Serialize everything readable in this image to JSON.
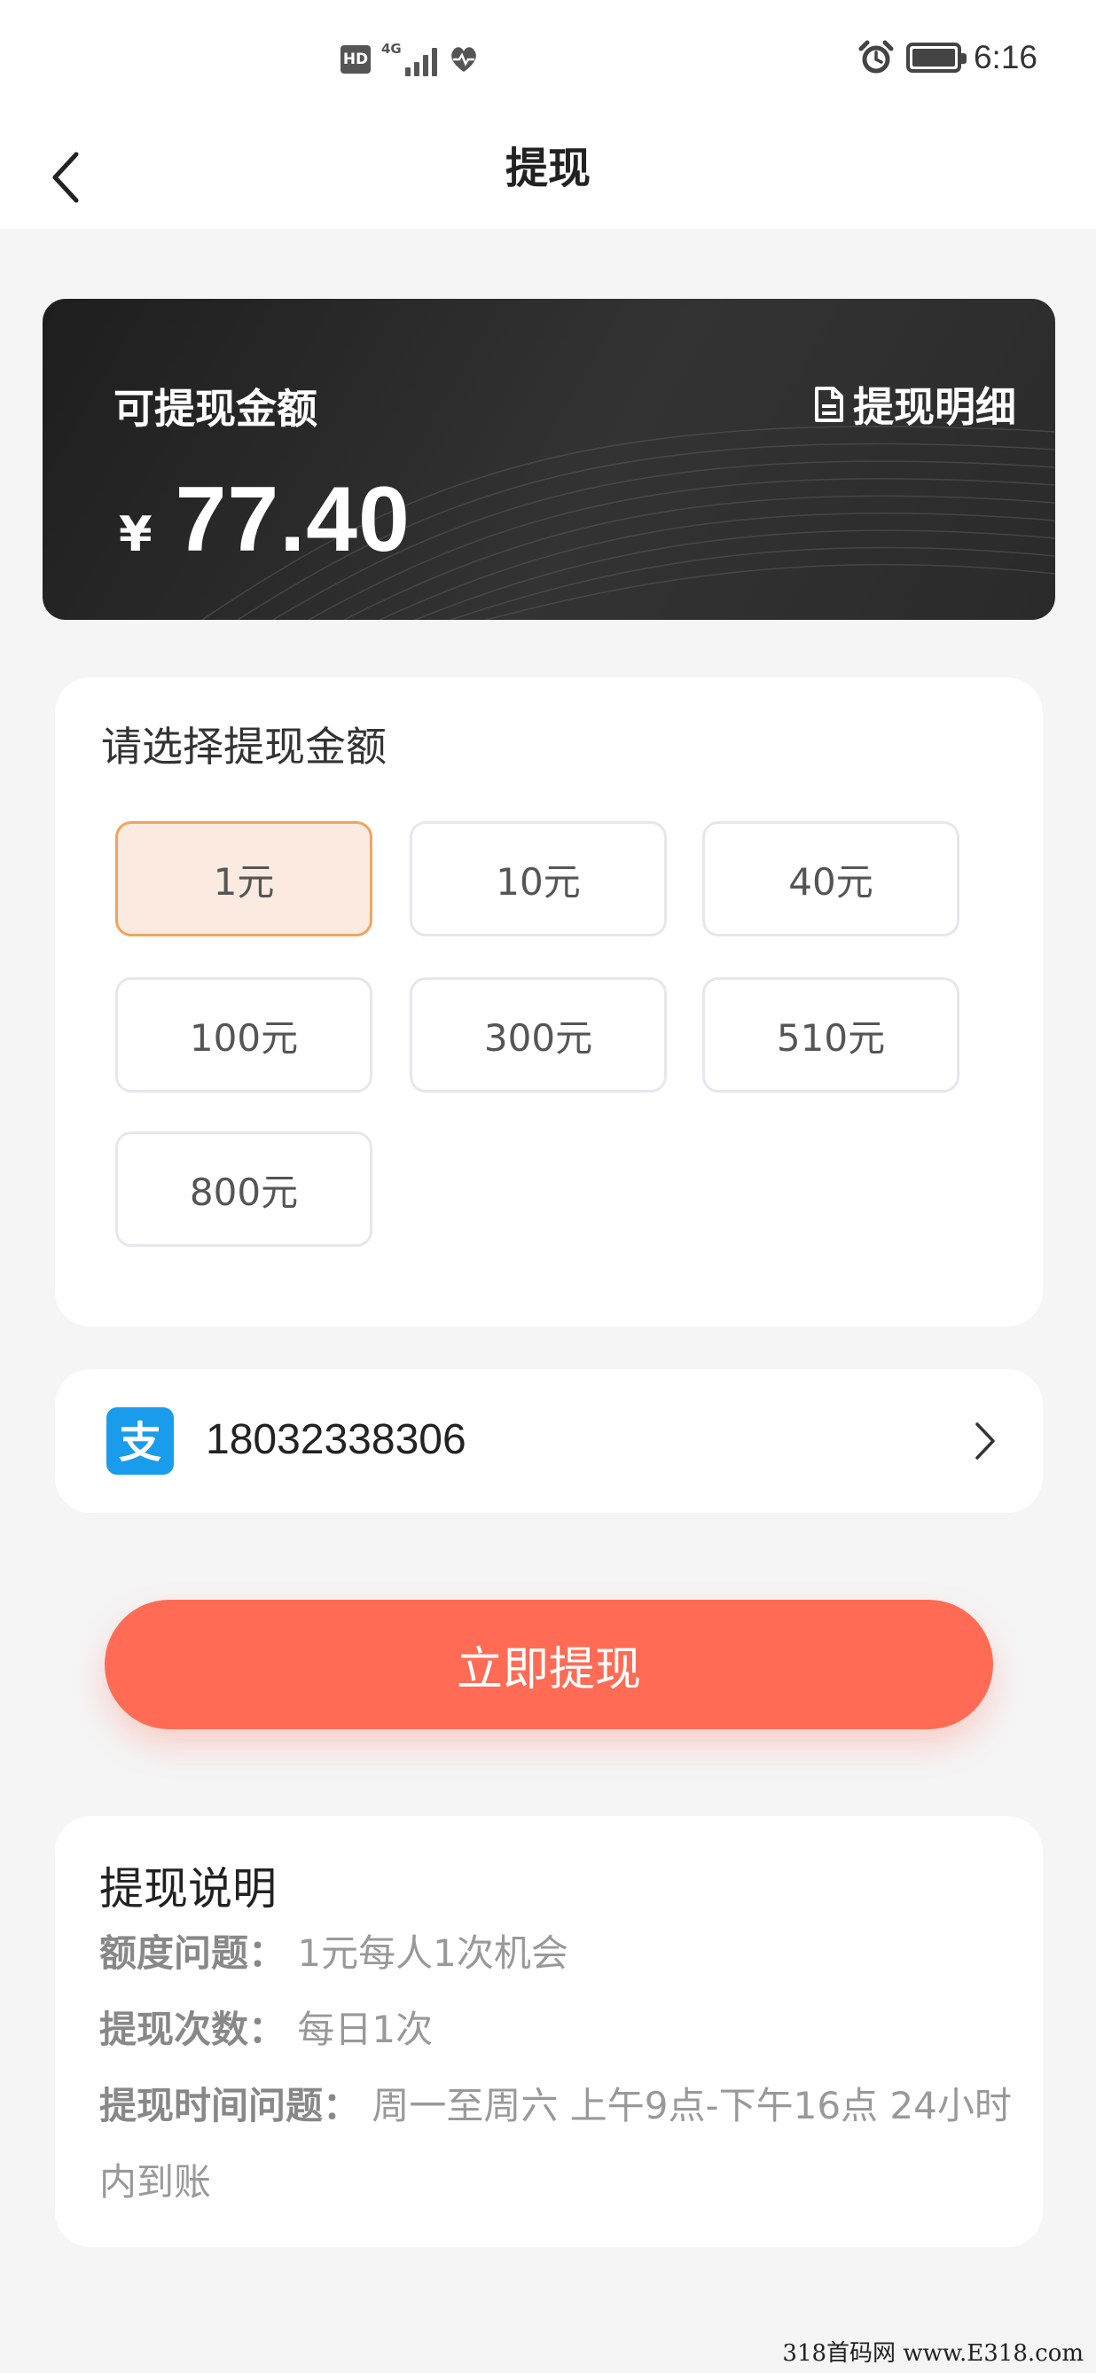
{
  "status_bar": {
    "hd_label": "HD",
    "network_label": "4G",
    "time": "6:16"
  },
  "header": {
    "title": "提现"
  },
  "balance": {
    "label": "可提现金额",
    "detail_link": "提现明细",
    "currency": "¥",
    "amount": "77.40"
  },
  "amount_selector": {
    "title": "请选择提现金额",
    "options": [
      "1元",
      "10元",
      "40元",
      "100元",
      "300元",
      "510元",
      "800元"
    ],
    "selected": "1元"
  },
  "account": {
    "icon_label": "支",
    "number": "18032338306"
  },
  "submit": {
    "label": "立即提现"
  },
  "notes": {
    "title": "提现说明",
    "items": [
      {
        "key": "额度问题：",
        "value": "1元每人1次机会"
      },
      {
        "key": "提现次数：",
        "value": "每日1次"
      },
      {
        "key": "提现时间问题：",
        "value": "周一至周六 上午9点-下午16点 24小时内到账"
      }
    ]
  },
  "watermark": "318首码网 www.E318.com",
  "colors": {
    "accent": "#ff6b55",
    "selected_bg": "#faeadf",
    "selected_border": "#f0a460",
    "card_dark": "#2a2a2a",
    "alipay_blue": "#1a9cec"
  }
}
